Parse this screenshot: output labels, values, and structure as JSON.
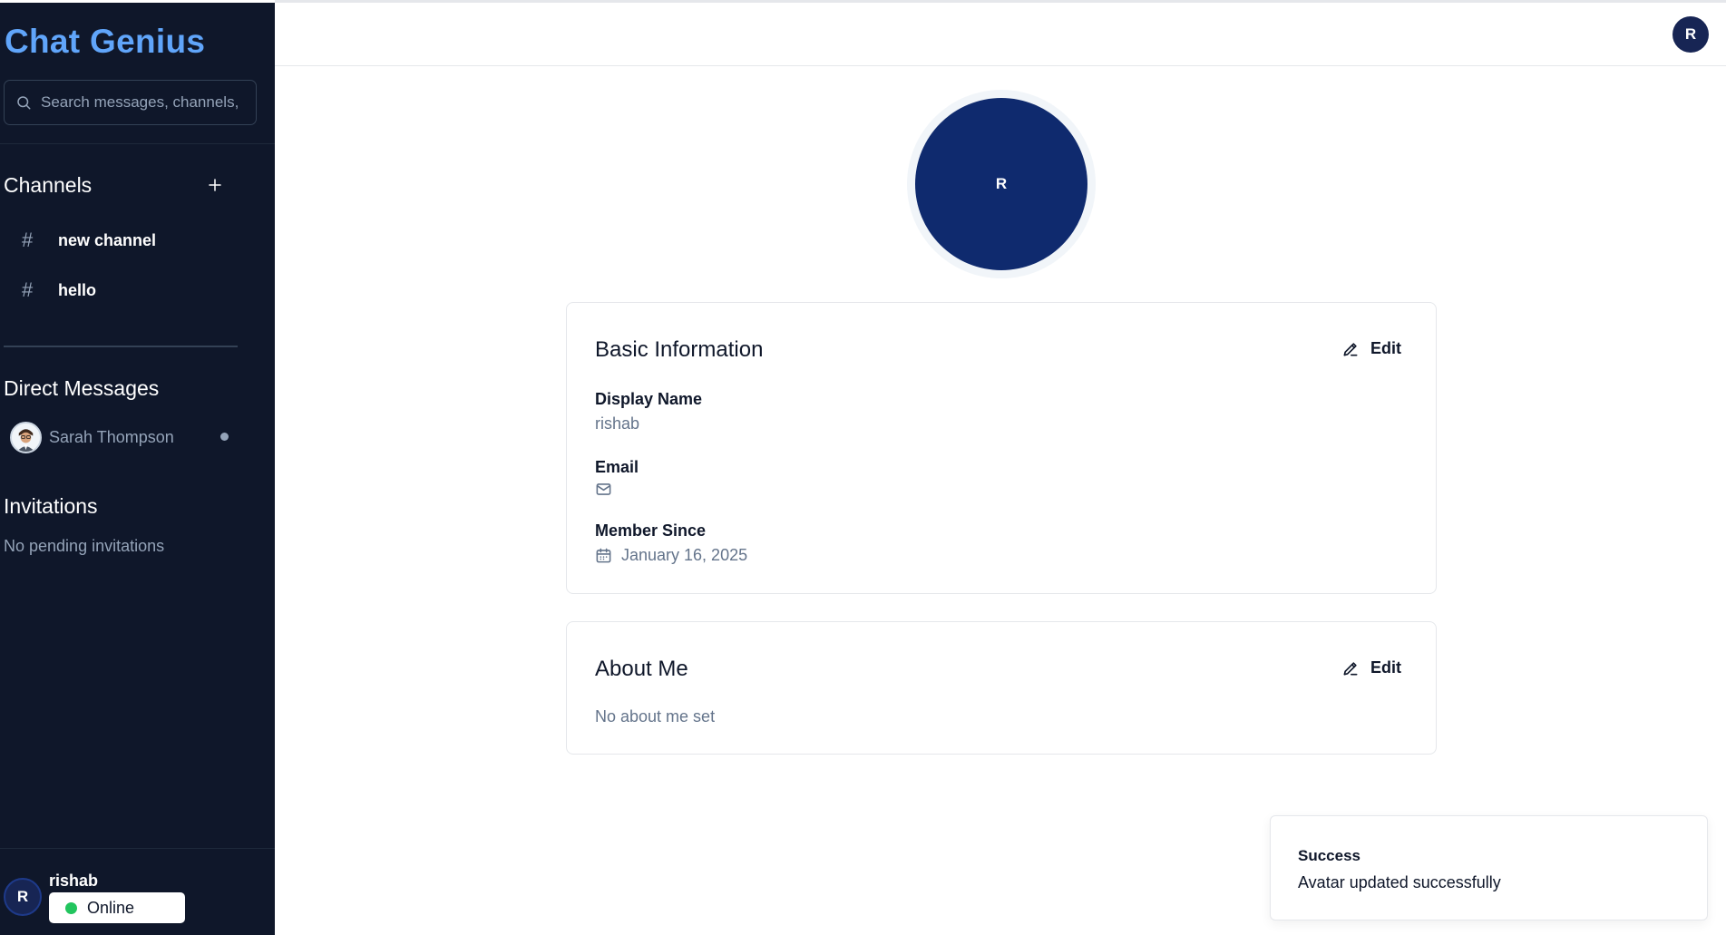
{
  "app": {
    "brand": "Chat Genius"
  },
  "search": {
    "placeholder": "Search messages, channels, c"
  },
  "sidebar": {
    "channels_title": "Channels",
    "add_channel_icon": "plus-icon",
    "channels": [
      {
        "label": "new channel",
        "icon": "hash-icon"
      },
      {
        "label": "hello",
        "icon": "hash-icon"
      }
    ],
    "dm_title": "Direct Messages",
    "direct_messages": [
      {
        "name": "Sarah Thompson",
        "status": "offline"
      }
    ],
    "invitations_title": "Invitations",
    "invitations_empty": "No pending invitations"
  },
  "current_user": {
    "initial": "R",
    "name": "rishab",
    "status": "Online",
    "status_color": "#22c55e"
  },
  "profile": {
    "avatar_initial": "R",
    "basic_info": {
      "title": "Basic Information",
      "edit_label": "Edit",
      "display_name_label": "Display Name",
      "display_name_value": "rishab",
      "email_label": "Email",
      "email_value": "",
      "member_since_label": "Member Since",
      "member_since_value": "January 16, 2025"
    },
    "about": {
      "title": "About Me",
      "edit_label": "Edit",
      "value": "No about me set"
    }
  },
  "toast": {
    "title": "Success",
    "description": "Avatar updated successfully"
  },
  "colors": {
    "sidebar_bg": "#0f172a",
    "brand": "#60a5fa",
    "avatar_bg": "#0f2a6e",
    "online": "#22c55e"
  }
}
